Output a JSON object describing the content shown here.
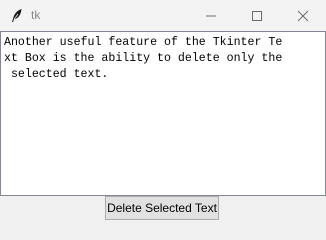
{
  "window": {
    "title": "tk",
    "icon": "feather-icon"
  },
  "controls": {
    "minimize_icon": "minimize-icon",
    "maximize_icon": "maximize-icon",
    "close_icon": "close-icon"
  },
  "textbox": {
    "lines": [
      "Another useful feature of the Tkinter Te",
      "xt Box is the ability to delete only the",
      " selected text."
    ]
  },
  "actions": {
    "delete_selected_label": "Delete Selected Text"
  },
  "colors": {
    "window_bg": "#f0f0f0",
    "titlebar_bg": "#f3f3f3",
    "textbox_bg": "#ffffff",
    "button_bg": "#e1e1e1",
    "button_border": "#adadad"
  }
}
